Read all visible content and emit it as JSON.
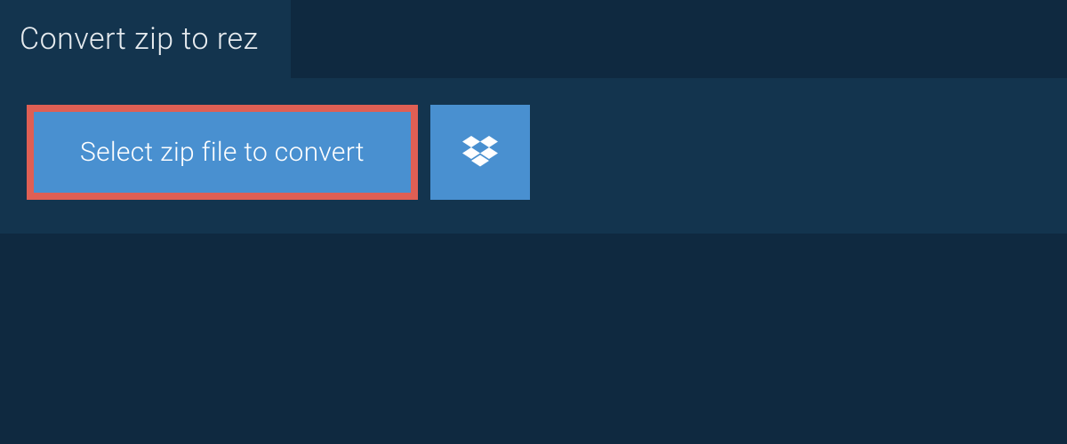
{
  "tab": {
    "label": "Convert zip to rez"
  },
  "actions": {
    "select_file_label": "Select zip file to convert"
  },
  "colors": {
    "background": "#0f2940",
    "panel": "#13344e",
    "button_bg": "#4990d0",
    "button_border": "#df5f54",
    "text_light": "#ffffff",
    "text_tab": "#e6ebef"
  }
}
